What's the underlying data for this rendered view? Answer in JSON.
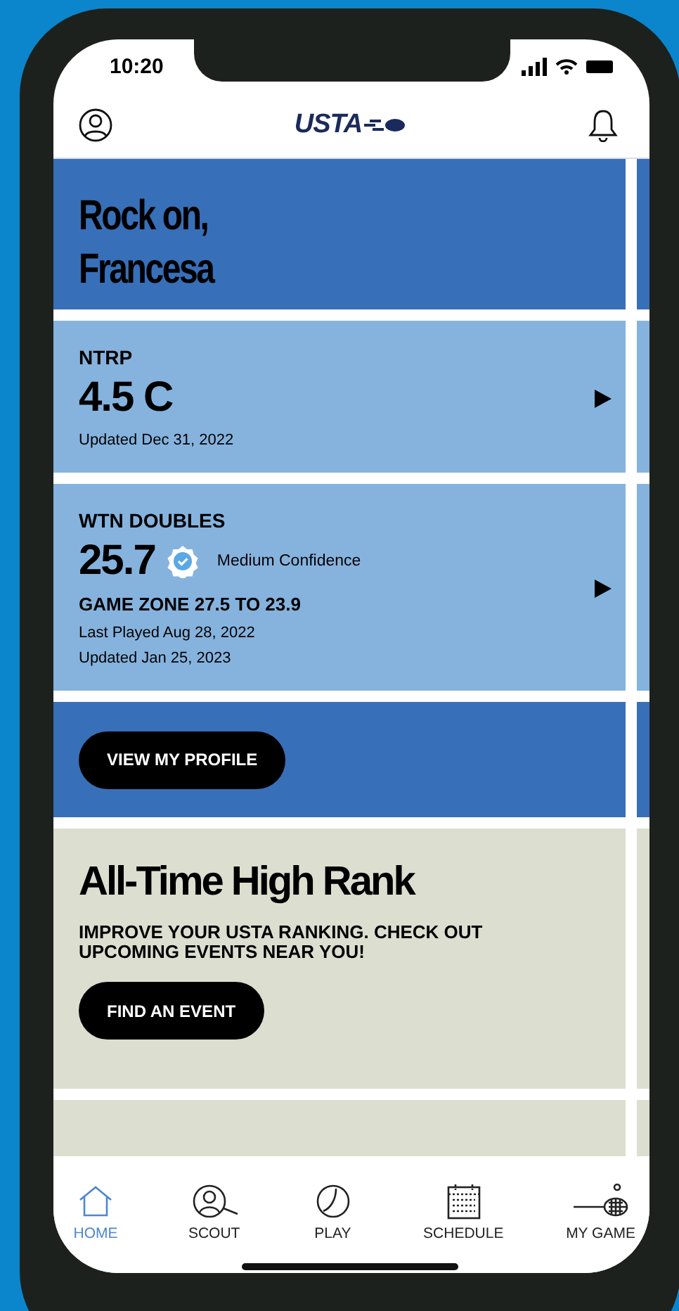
{
  "status_bar": {
    "time": "10:20"
  },
  "header": {
    "logo": "USTA"
  },
  "greeting": "Rock on, Francesa",
  "ratings": [
    {
      "kind": "ntrp",
      "label": "NTRP",
      "value": "4.5 C",
      "lines": [
        "Updated Dec 31, 2022"
      ]
    },
    {
      "kind": "wtn",
      "label": "WTN DOUBLES",
      "value": "25.7",
      "confidence": "Medium Confidence",
      "game_zone": "GAME ZONE 27.5 TO 23.9",
      "lines": [
        "Last Played Aug 28, 2022",
        "Updated Jan 25, 2023"
      ]
    }
  ],
  "profile_button": "VIEW MY PROFILE",
  "promo": {
    "title": "All-Time High Rank",
    "text": "IMPROVE YOUR USTA RANKING.  CHECK OUT UPCOMING EVENTS NEAR YOU!",
    "button": "FIND AN EVENT"
  },
  "tabs": [
    {
      "label": "HOME",
      "selected": true
    },
    {
      "label": "SCOUT",
      "selected": false
    },
    {
      "label": "PLAY",
      "selected": false
    },
    {
      "label": "SCHEDULE",
      "selected": false
    },
    {
      "label": "MY GAME",
      "selected": false
    }
  ]
}
